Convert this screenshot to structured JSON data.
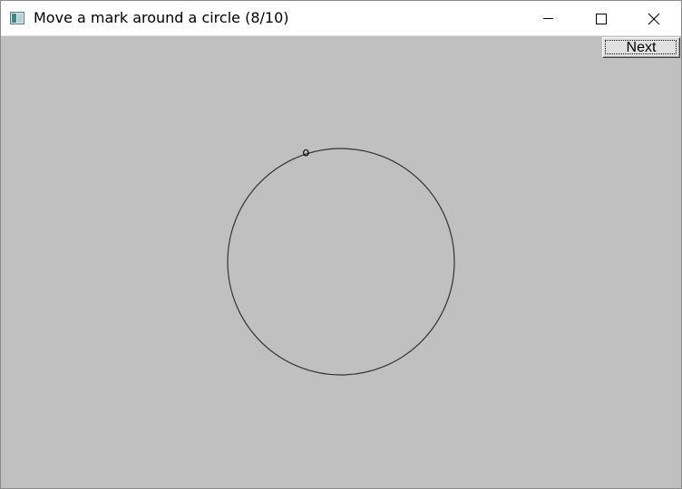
{
  "window": {
    "title": "Move a mark around a circle (8/10)",
    "icon": "app-window-icon"
  },
  "titlebar_controls": {
    "minimize_icon": "minimize-icon",
    "maximize_icon": "maximize-icon",
    "close_icon": "close-icon"
  },
  "toolbar": {
    "next_label": "Next"
  },
  "task": {
    "progress_current": 8,
    "progress_total": 10,
    "mark_label": "o",
    "mark_angle_deg": 108
  },
  "colors": {
    "client_background": "#c0c0c0",
    "titlebar_background": "#ffffff",
    "circle_stroke": "#333333"
  }
}
